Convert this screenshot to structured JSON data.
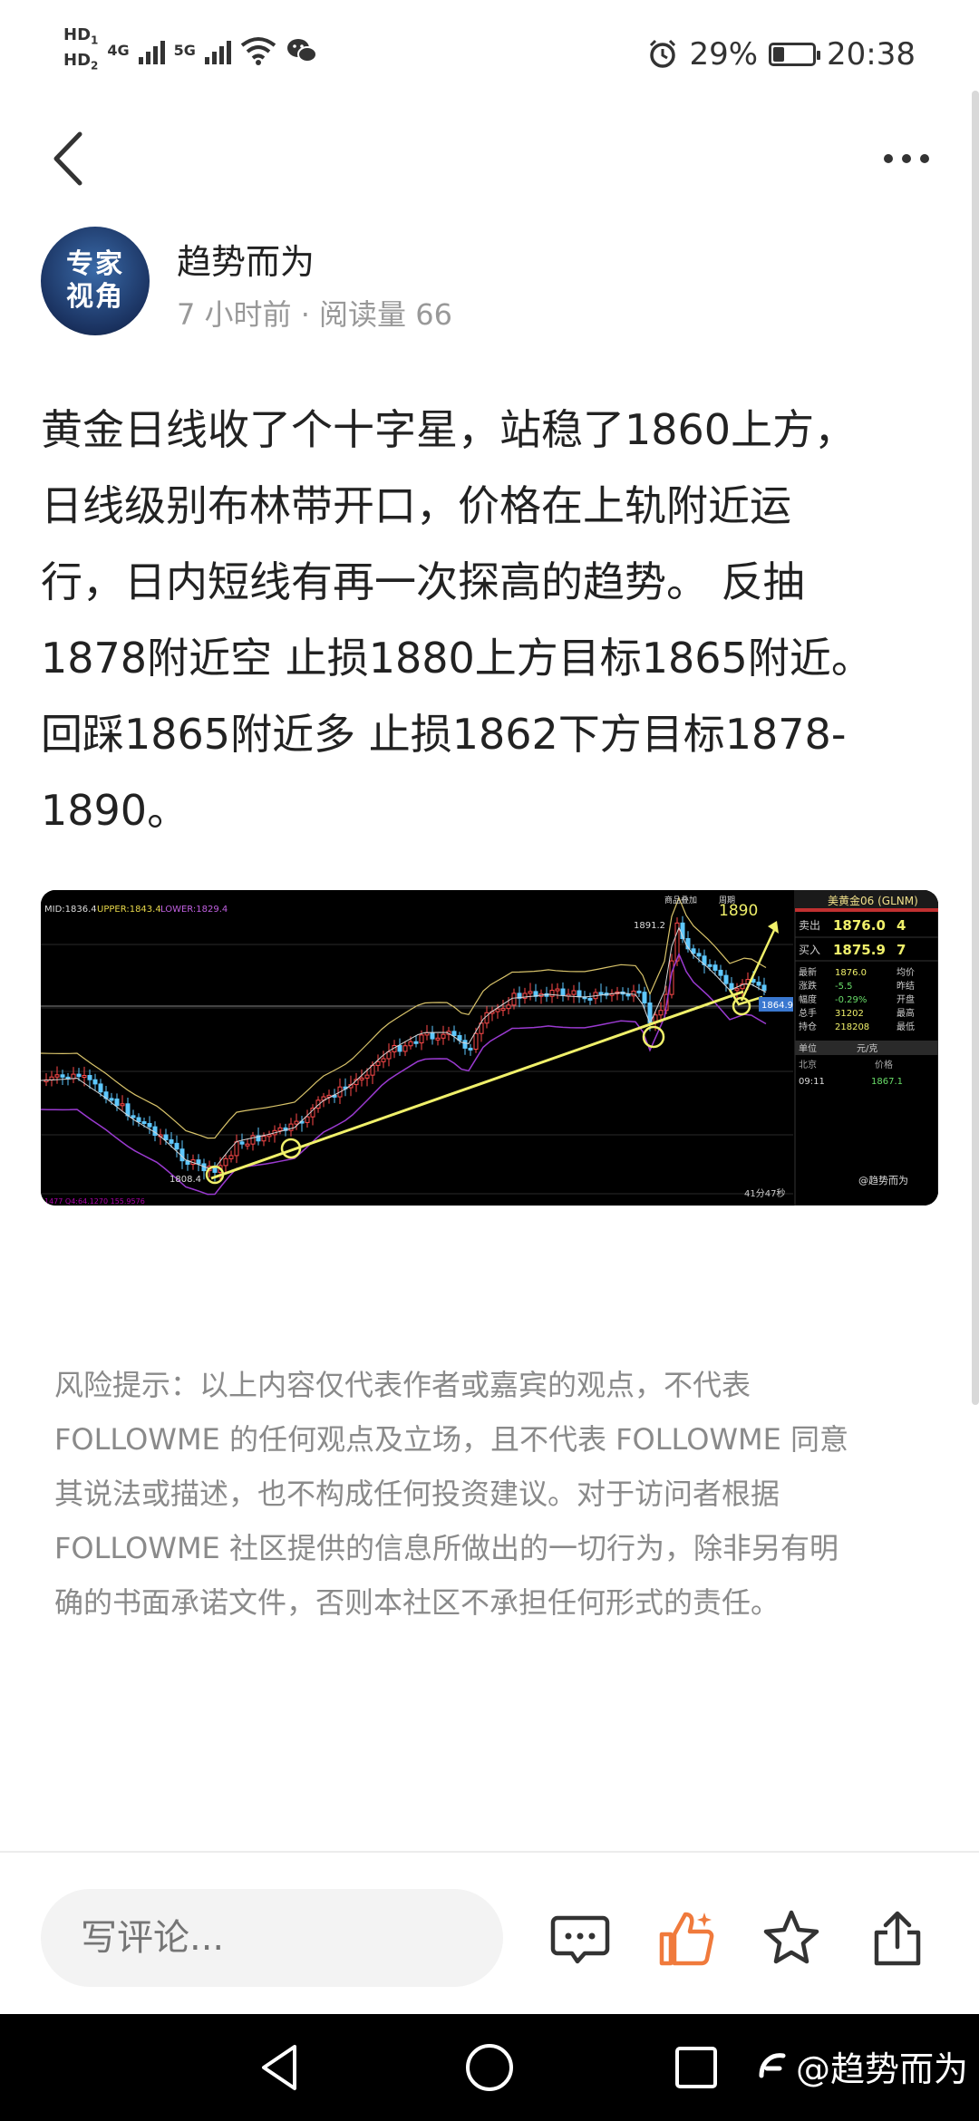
{
  "status_bar": {
    "hd1": "HD",
    "hd1_sub": "1",
    "hd2": "HD",
    "hd2_sub": "2",
    "net1": "4G",
    "net2": "5G",
    "battery_pct_text": "29%",
    "battery_level": 0.29,
    "time": "20:38",
    "icons": [
      "wifi-icon",
      "wechat-icon",
      "alarm-icon",
      "battery-icon"
    ]
  },
  "header": {
    "back_icon": "chevron-left-icon",
    "more_icon": "more-horizontal-icon"
  },
  "author": {
    "avatar_text_line1": "专家",
    "avatar_text_line2": "视角",
    "name": "趋势而为",
    "meta": "7 小时前 · 阅读量 66"
  },
  "article": {
    "lines": [
      "黄金日线收了个十字星，站稳了1860上方，",
      "日线级别布林带开口，价格在上轨附近运",
      "行，日内短线有再一次探高的趋势。 反抽",
      "1878附近空 止损1880上方目标1865附近。",
      "回踩1865附近多 止损1862下方目标1878-",
      "1890。"
    ]
  },
  "chart": {
    "indicator_label": "MID:1836.4 UPPER:1843.4 LOWER:1829.4",
    "indicator_mid": "MID:1836.4",
    "indicator_upper": "UPPER:1843.4",
    "indicator_lower": "LOWER:1829.4",
    "top_tab1": "商品叠加",
    "top_tab2": "周期",
    "price_high_label": "1891.2",
    "price_low_label": "1808.4",
    "target_label": "1890",
    "current_price_tag": "1864.9",
    "time_label": "41分47秒",
    "bottom_label": "1477 Q4:64.1270 155.9576",
    "panel": {
      "title": "美黄金06 (GLNM)",
      "sell_label": "卖出",
      "sell_price": "1876.0",
      "sell_qty": "4",
      "buy_label": "买入",
      "buy_price": "1875.9",
      "buy_qty": "7",
      "rows": [
        {
          "k": "最新",
          "v": "1876.0",
          "k2": "均价"
        },
        {
          "k": "涨跌",
          "v": "-5.5",
          "k2": "昨结"
        },
        {
          "k": "幅度",
          "v": "-0.29%",
          "k2": "开盘"
        },
        {
          "k": "总手",
          "v": "31202",
          "k2": "最高"
        },
        {
          "k": "持仓",
          "v": "218208",
          "k2": "最低"
        }
      ],
      "unit_label": "单位",
      "unit_value": "元/克",
      "city_label": "北京",
      "price_label": "价格",
      "tick_time": "09:11",
      "tick_price": "1867.1",
      "watermark": "@趋势而为"
    }
  },
  "risk_notice": {
    "lines": [
      "风险提示：以上内容仅代表作者或嘉宾的观点，不代表",
      "FOLLOWME 的任何观点及立场，且不代表 FOLLOWME 同意",
      "其说法或描述，也不构成任何投资建议。对于访问者根据",
      "FOLLOWME 社区提供的信息所做出的一切行为，除非另有明",
      "确的书面承诺文件，否则本社区不承担任何形式的责任。"
    ]
  },
  "comment_bar": {
    "placeholder": "写评论...",
    "icons": [
      "comment-icon",
      "like-icon",
      "star-icon",
      "share-icon"
    ],
    "like_color": "#f07a3c"
  },
  "nav_bar": {
    "icons": [
      "nav-back-icon",
      "nav-home-icon",
      "nav-recents-icon"
    ],
    "watermark": "@趋势而为"
  }
}
